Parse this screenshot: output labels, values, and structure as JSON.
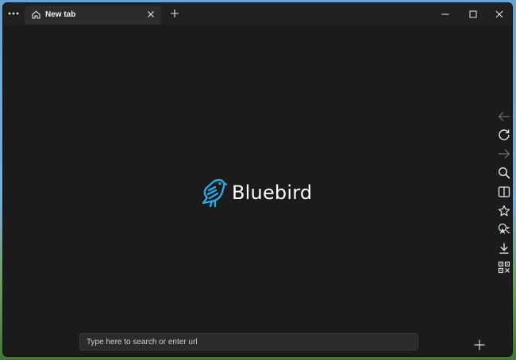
{
  "titlebar": {
    "menu_icon": "more-dots-icon",
    "tab": {
      "label": "New tab",
      "icon": "home-icon",
      "close_icon": "close-icon"
    },
    "new_tab_icon": "plus-icon",
    "controls": [
      "minimize-icon",
      "maximize-icon",
      "close-icon"
    ]
  },
  "main": {
    "brand_name": "Bluebird",
    "logo_icon": "bluebird-logo-icon",
    "search": {
      "placeholder": "Type here to search or enter url",
      "value": ""
    },
    "add_icon": "plus-icon"
  },
  "sidebar": {
    "items": [
      {
        "icon": "back-arrow-icon",
        "enabled": false
      },
      {
        "icon": "refresh-icon",
        "enabled": true
      },
      {
        "icon": "forward-arrow-icon",
        "enabled": false
      },
      {
        "icon": "search-icon",
        "enabled": true
      },
      {
        "icon": "reading-view-icon",
        "enabled": true
      },
      {
        "icon": "star-icon",
        "enabled": true
      },
      {
        "icon": "translate-icon",
        "enabled": true
      },
      {
        "icon": "download-icon",
        "enabled": true
      },
      {
        "icon": "qr-code-icon",
        "enabled": true
      }
    ]
  },
  "colors": {
    "window_bg": "#1b1b1b",
    "titlebar_bg": "#202020",
    "tab_bg": "#2c2c2c",
    "accent_logo": "#29a8e8",
    "icon_color": "#e6e6e6",
    "disabled_icon_color": "#6b6b6b"
  }
}
